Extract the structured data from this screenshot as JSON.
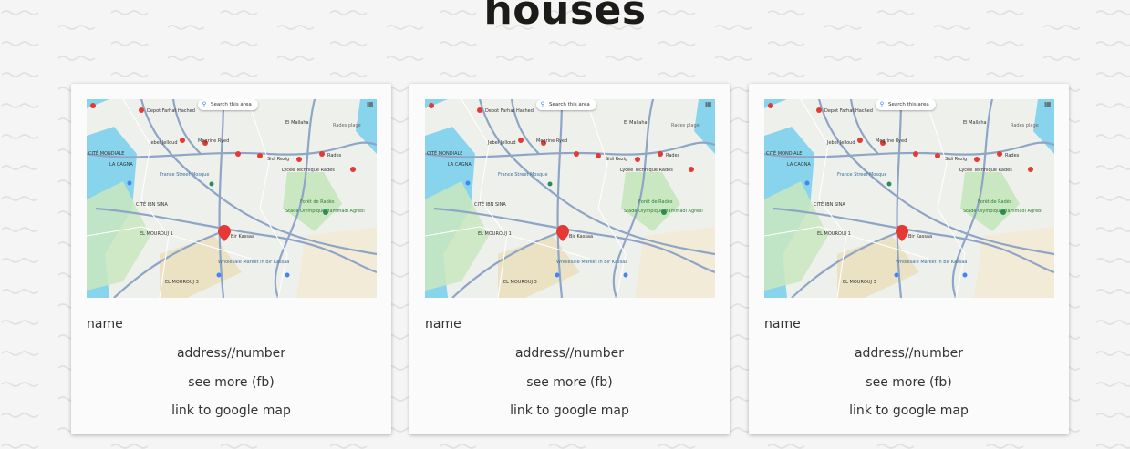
{
  "page": {
    "title": "houses"
  },
  "cards": [
    {
      "name": "name",
      "address": "address//number",
      "more": "see more (fb)",
      "map_link": "link to google map",
      "map": {
        "search_label": "Search this area",
        "places": {
          "depot": "Depot Farhat Hached",
          "mallaha": "El Mallaha",
          "rades_plage": "Rades plage",
          "mourouj1": "EL MOUROUJ 1",
          "mourouj3": "EL MOUROUJ 3",
          "bir_kassaa": "Bir Kassaa",
          "foret": "Forêt de Radès",
          "stade": "Stade Olympique Hammadi Agrebi",
          "wholesale": "Wholesale Market in Bir Kassaa",
          "mosque": "France Street Mosque",
          "cite_ibn_sina": "CITÉ IBN SINA",
          "cite_mondiale": "CITÉ MONDIALE",
          "la_cagna": "LA CAGNA",
          "jebel_jelloud": "Jebel Jelloud",
          "megrine": "Megrine Ryed",
          "sidi_rezig": "Sidi Rezig",
          "rades": "Rades",
          "lycee": "Lycée Technique Rades"
        }
      }
    },
    {
      "name": "name",
      "address": "address//number",
      "more": "see more (fb)",
      "map_link": "link to google map",
      "map": {
        "search_label": "Search this area",
        "places": {
          "depot": "Depot Farhat Hached",
          "mallaha": "El Mallaha",
          "rades_plage": "Rades plage",
          "mourouj1": "EL MOUROUJ 1",
          "mourouj3": "EL MOUROUJ 3",
          "bir_kassaa": "Bir Kassaa",
          "foret": "Forêt de Radès",
          "stade": "Stade Olympique Hammadi Agrebi",
          "wholesale": "Wholesale Market in Bir Kassaa",
          "mosque": "France Street Mosque",
          "cite_ibn_sina": "CITÉ IBN SINA",
          "cite_mondiale": "CITÉ MONDIALE",
          "la_cagna": "LA CAGNA",
          "jebel_jelloud": "Jebel Jelloud",
          "megrine": "Megrine Ryed",
          "sidi_rezig": "Sidi Rezig",
          "rades": "Rades",
          "lycee": "Lycée Technique Rades"
        }
      }
    },
    {
      "name": "name",
      "address": "address//number",
      "more": "see more (fb)",
      "map_link": "link to google map",
      "map": {
        "search_label": "Search this area",
        "places": {
          "depot": "Depot Farhat Hached",
          "mallaha": "El Mallaha",
          "rades_plage": "Rades plage",
          "mourouj1": "EL MOUROUJ 1",
          "mourouj3": "EL MOUROUJ 3",
          "bir_kassaa": "Bir Kassaa",
          "foret": "Forêt de Radès",
          "stade": "Stade Olympique Hammadi Agrebi",
          "wholesale": "Wholesale Market in Bir Kassaa",
          "mosque": "France Street Mosque",
          "cite_ibn_sina": "CITÉ IBN SINA",
          "cite_mondiale": "CITÉ MONDIALE",
          "la_cagna": "LA CAGNA",
          "jebel_jelloud": "Jebel Jelloud",
          "megrine": "Megrine Ryed",
          "sidi_rezig": "Sidi Rezig",
          "rades": "Rades",
          "lycee": "Lycée Technique Rades"
        }
      }
    }
  ],
  "colors": {
    "page_bg": "#f5f5f5",
    "card_bg": "#fbfbfb",
    "title": "#1b1b17",
    "text": "#333333",
    "map_water": "#88d4ec",
    "map_park": "#c9e7c0",
    "map_road": "#8fa5c6",
    "map_pin": "#e53935"
  }
}
